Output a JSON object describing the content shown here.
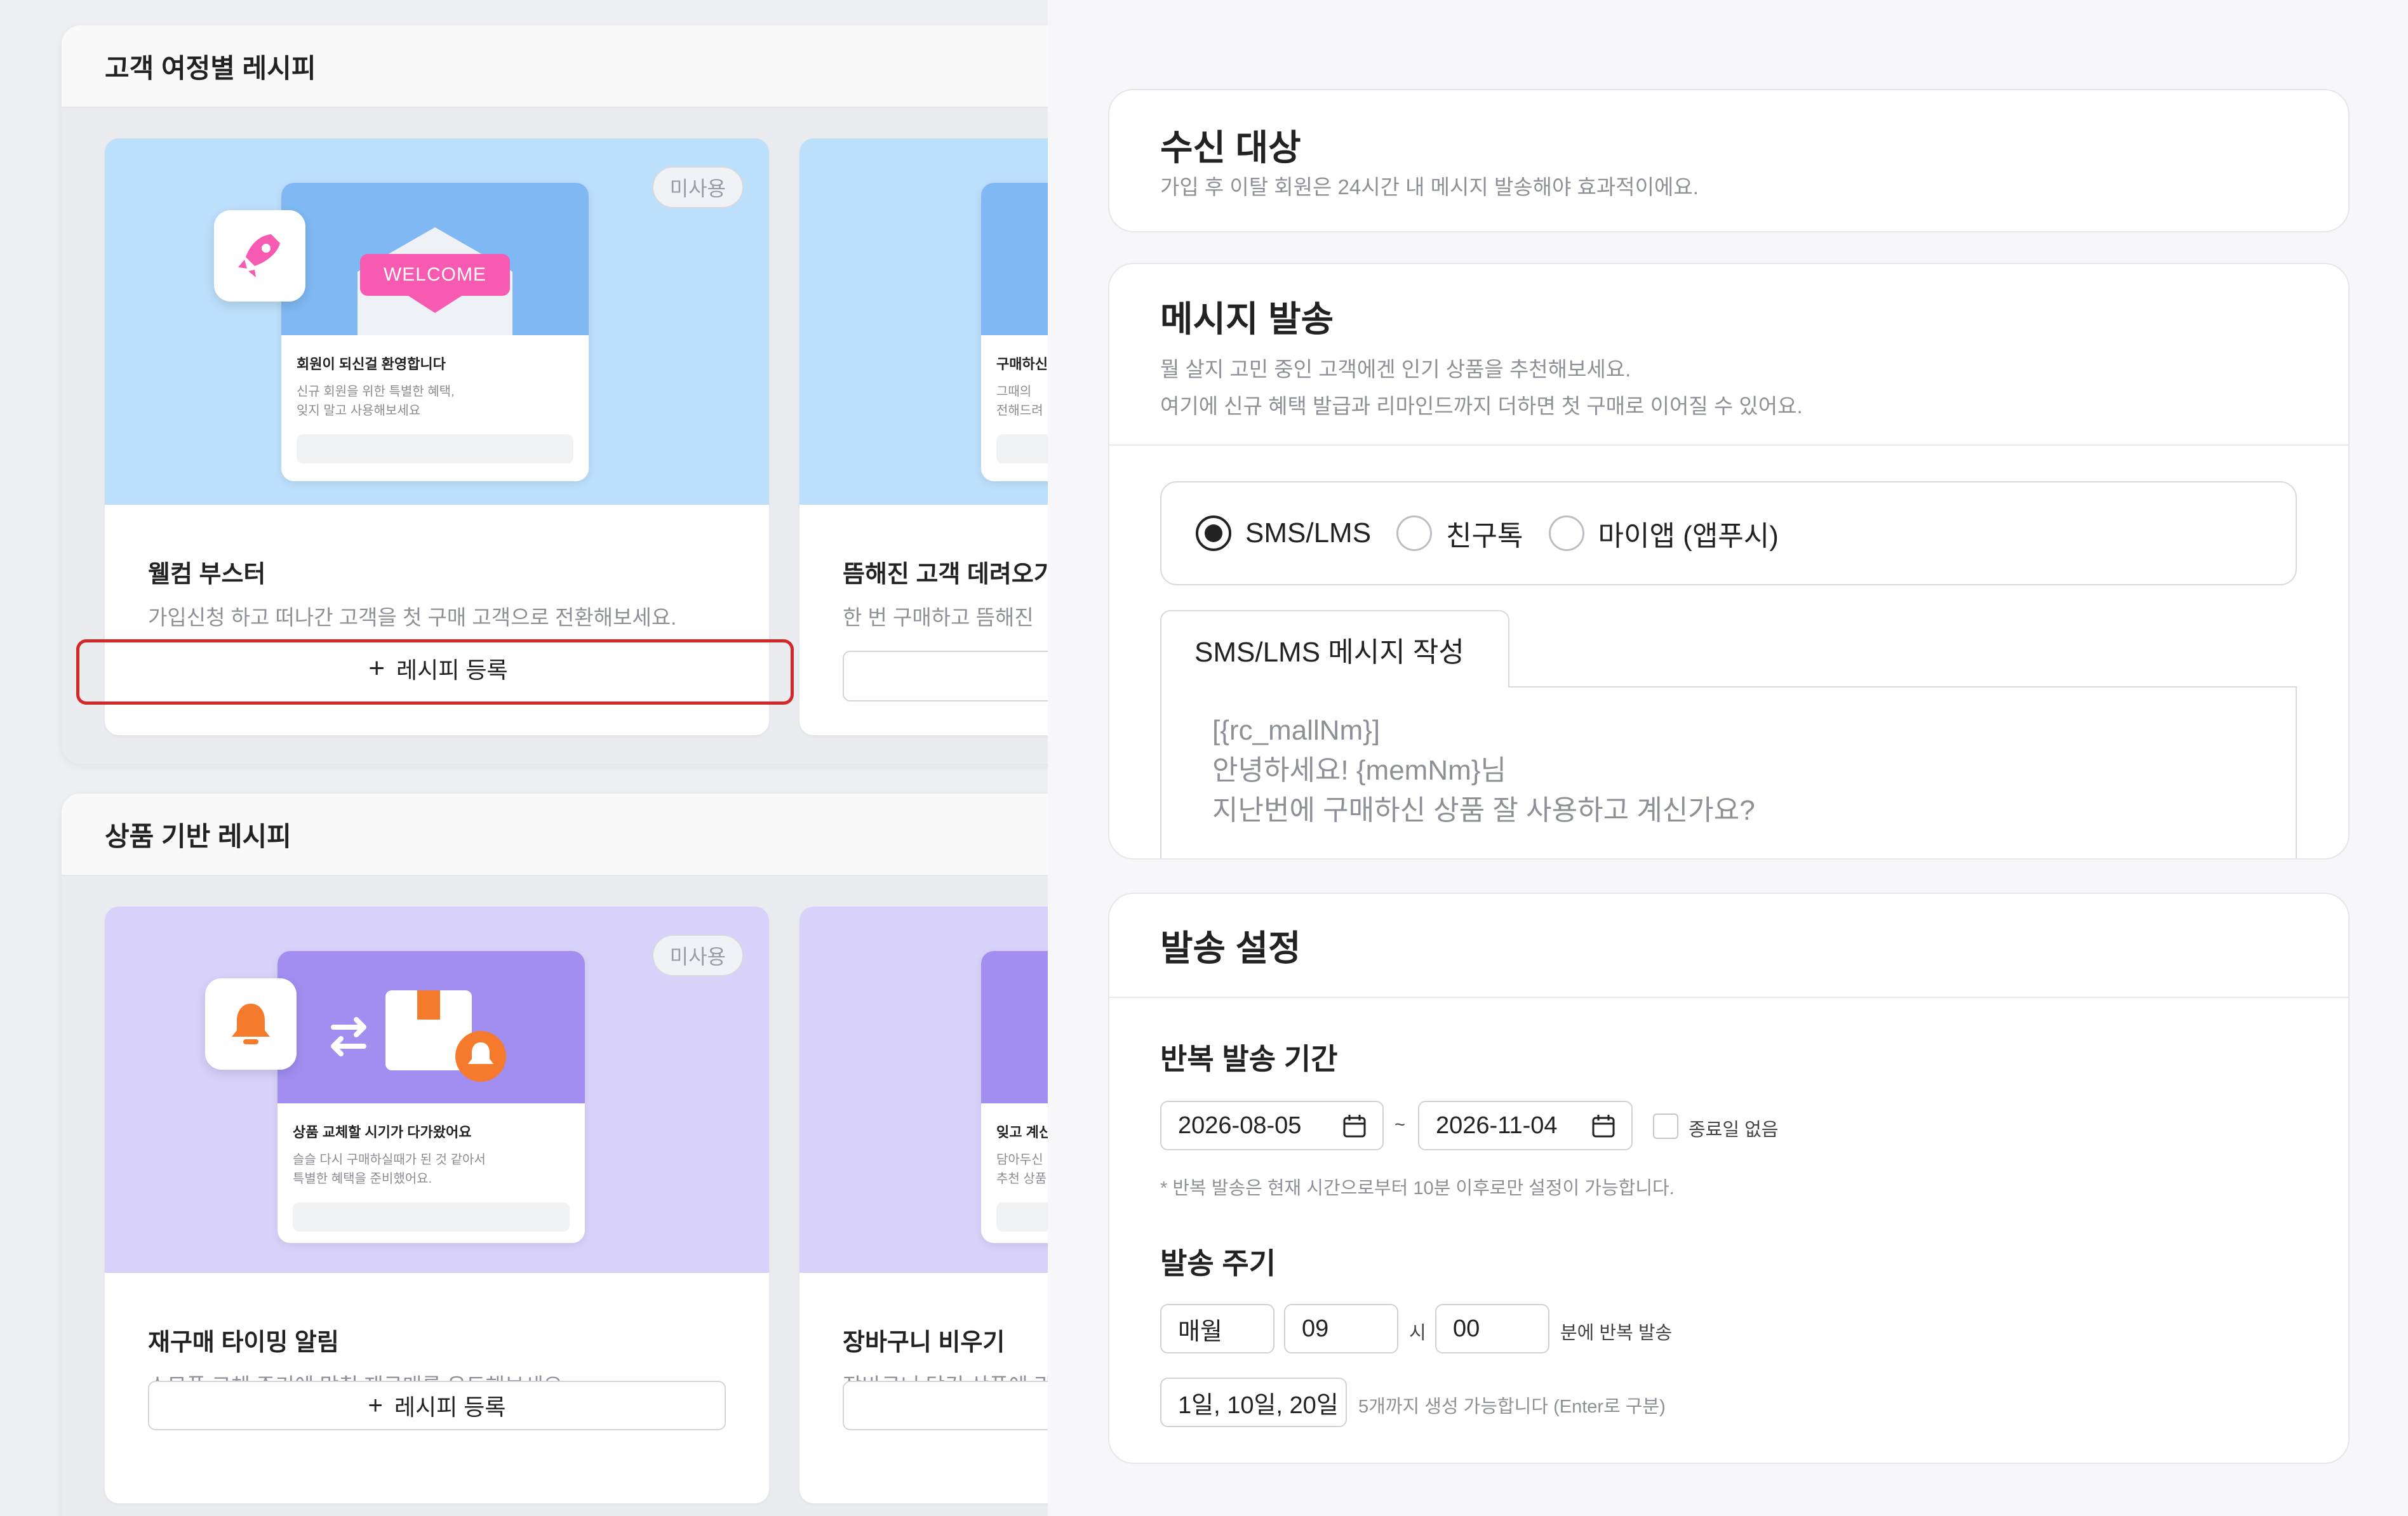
{
  "left": {
    "sections": [
      {
        "title": "고객 여정별 레시피",
        "cards": [
          {
            "badge": "미사용",
            "mock_banner": "WELCOME",
            "mock_title": "회원이 되신걸 환영합니다",
            "mock_lines": [
              "신규 회원을 위한 특별한 혜택,",
              "잊지 말고 사용해보세요"
            ],
            "title": "웰컴 부스터",
            "desc": "가입신청 하고 떠나간 고객을 첫 구매 고객으로 전환해보세요.",
            "button": "레시피 등록"
          },
          {
            "mock_title": "구매하신",
            "mock_lines": [
              "그때의 ",
              "전해드려"
            ],
            "title": "뜸해진 고객 데려오기",
            "desc": "한 번 구매하고 뜸해진"
          }
        ]
      },
      {
        "title": "상품 기반 레시피",
        "cards": [
          {
            "badge": "미사용",
            "mock_title": "상품 교체할 시기가 다가왔어요",
            "mock_lines": [
              "슬슬 다시 구매하실때가 된 것 같아서",
              "특별한 혜택을 준비했어요."
            ],
            "title": "재구매 타이밍 알림",
            "desc": "소모품 교체 주기에 맞춰 재구매를 유도해보세요.",
            "button": "레시피 등록"
          },
          {
            "mock_title": "잊고 계신",
            "mock_lines": [
              "담아두신",
              "추천 상품"
            ],
            "title": "장바구니 비우기",
            "desc": "장바구니 담긴 상품에 관"
          }
        ]
      }
    ]
  },
  "right": {
    "recipient": {
      "title": "수신 대상",
      "desc": "가입 후 이탈 회원은 24시간 내 메시지 발송해야 효과적이에요."
    },
    "message": {
      "title": "메시지 발송",
      "desc_lines": [
        "뭘 살지 고민 중인 고객에겐 인기 상품을 추천해보세요.",
        "여기에 신규 혜택 발급과 리마인드까지 더하면 첫 구매로 이어질 수 있어요."
      ],
      "channels": [
        "SMS/LMS",
        "친구톡",
        "마이앱 (앱푸시)"
      ],
      "selected_channel": "SMS/LMS",
      "tab": "SMS/LMS 메시지 작성",
      "body_lines": [
        "[{rc_mallNm}]",
        "안녕하세요! {memNm}님",
        "지난번에 구매하신 상품 잘 사용하고 계신가요?"
      ]
    },
    "schedule": {
      "title": "발송 설정",
      "period_label": "반복 발송 기간",
      "start_date": "2026-08-05",
      "range_sep": "~",
      "end_date": "2026-11-04",
      "no_end_label": "종료일 없음",
      "period_note": "* 반복 발송은 현재 시간으로부터 10분 이후로만 설정이 가능합니다.",
      "cycle_label": "발송 주기",
      "cycle_unit": "매월",
      "hour": "09",
      "hour_suffix": "시",
      "minute": "00",
      "minute_suffix": "분에 반복 발송",
      "days": "1일, 10일, 20일",
      "days_hint": "5개까지 생성 가능합니다 (Enter로 구분)"
    }
  },
  "colors": {
    "highlight": "#d32828",
    "blue_visual": "#bcdffb",
    "purple_visual": "#d8d2fb",
    "welcome_pink": "#f75ab1",
    "bell_orange": "#f57a2b"
  }
}
